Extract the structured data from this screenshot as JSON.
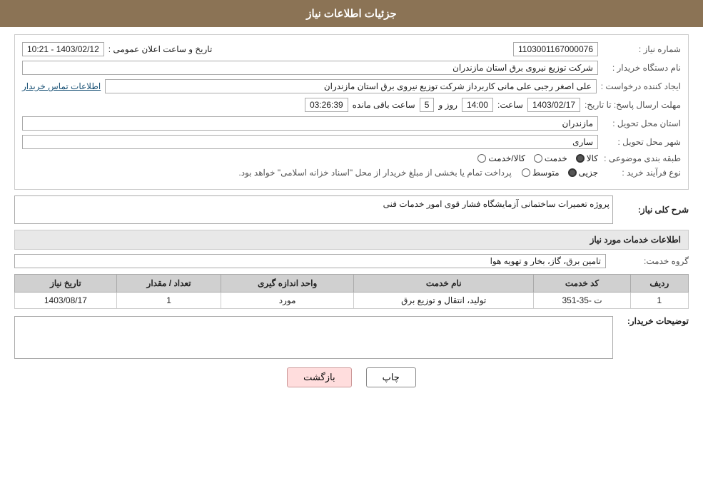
{
  "header": {
    "title": "جزئیات اطلاعات نیاز"
  },
  "fields": {
    "need_number_label": "شماره نیاز :",
    "need_number_value": "1103001167000076",
    "announce_date_label": "تاریخ و ساعت اعلان عمومی :",
    "announce_date_value": "1403/02/12 - 10:21",
    "buyer_org_label": "نام دستگاه خریدار :",
    "buyer_org_value": "شرکت توزیع نیروی برق استان مازندران",
    "creator_label": "ایجاد کننده درخواست :",
    "creator_value": "علی اصغر رجبی علی مانی کاربرداز شرکت توزیع نیروی برق استان مازندران",
    "contact_link": "اطلاعات تماس خریدار",
    "reply_deadline_label": "مهلت ارسال پاسخ: تا تاریخ:",
    "reply_date": "1403/02/17",
    "reply_time_label": "ساعت:",
    "reply_time": "14:00",
    "reply_days_label": "روز و",
    "reply_days": "5",
    "reply_remaining_label": "ساعت باقی مانده",
    "reply_remaining": "03:26:39",
    "delivery_province_label": "استان محل تحویل :",
    "delivery_province_value": "مازندران",
    "delivery_city_label": "شهر محل تحویل :",
    "delivery_city_value": "ساری",
    "category_label": "طبقه بندی موضوعی :",
    "category_options": [
      "کالا",
      "خدمت",
      "کالا/خدمت"
    ],
    "category_selected": "کالا",
    "purchase_type_label": "نوع فرآیند خرید :",
    "purchase_types": [
      "جزیی",
      "متوسط"
    ],
    "purchase_note": "پرداخت تمام یا بخشی از مبلغ خریدار از محل \"اسناد خزانه اسلامی\" خواهد بود.",
    "need_description_label": "شرح کلی نیاز:",
    "need_description_value": "پروژه تعمیرات ساختمانی آزمایشگاه فشار قوی امور خدمات فنی"
  },
  "services_section": {
    "title": "اطلاعات خدمات مورد نیاز",
    "service_group_label": "گروه خدمت:",
    "service_group_value": "تامین برق، گاز، بخار و تهویه هوا",
    "table": {
      "headers": [
        "ردیف",
        "کد خدمت",
        "نام خدمت",
        "واحد اندازه گیری",
        "تعداد / مقدار",
        "تاریخ نیاز"
      ],
      "rows": [
        {
          "row": "1",
          "code": "ت -35-351",
          "name": "تولید، انتقال و توزیع برق",
          "unit": "مورد",
          "quantity": "1",
          "date": "1403/08/17"
        }
      ]
    }
  },
  "buyer_notes_label": "توضیحات خریدار:",
  "buyer_notes_value": "",
  "buttons": {
    "print": "چاپ",
    "back": "بازگشت"
  }
}
